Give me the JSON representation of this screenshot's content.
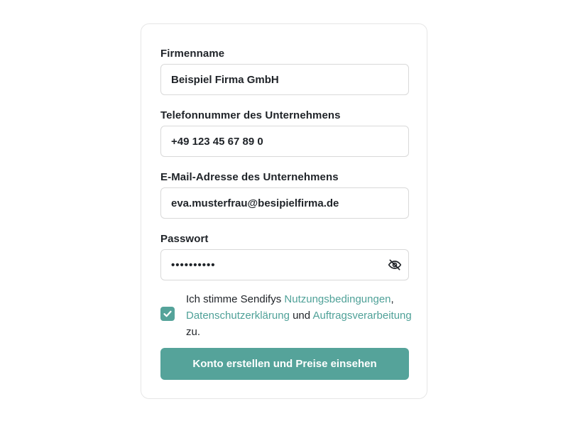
{
  "form": {
    "company_name": {
      "label": "Firmenname",
      "value": "Beispiel Firma GmbH"
    },
    "phone": {
      "label": "Telefonnummer des Unternehmens",
      "value": "+49 123 45 67 89 0"
    },
    "email": {
      "label": "E-Mail-Adresse des Unternehmens",
      "value": "eva.musterfrau@besipielfirma.de"
    },
    "password": {
      "label": "Passwort",
      "value": "••••••••••",
      "toggle_icon": "eye-off-icon"
    },
    "consent": {
      "checked": true,
      "text_before": "Ich stimme Sendifys ",
      "link_terms": "Nutzungsbedingungen",
      "sep1": ", ",
      "link_privacy": "Datenschutzerklärung",
      "sep2": " und ",
      "link_processing": "Auftragsverarbeitung",
      "text_after": " zu."
    },
    "submit_label": "Konto erstellen und Preise einsehen"
  },
  "colors": {
    "accent": "#55a39a",
    "link": "#4fa198",
    "border": "#d9d9d9"
  }
}
